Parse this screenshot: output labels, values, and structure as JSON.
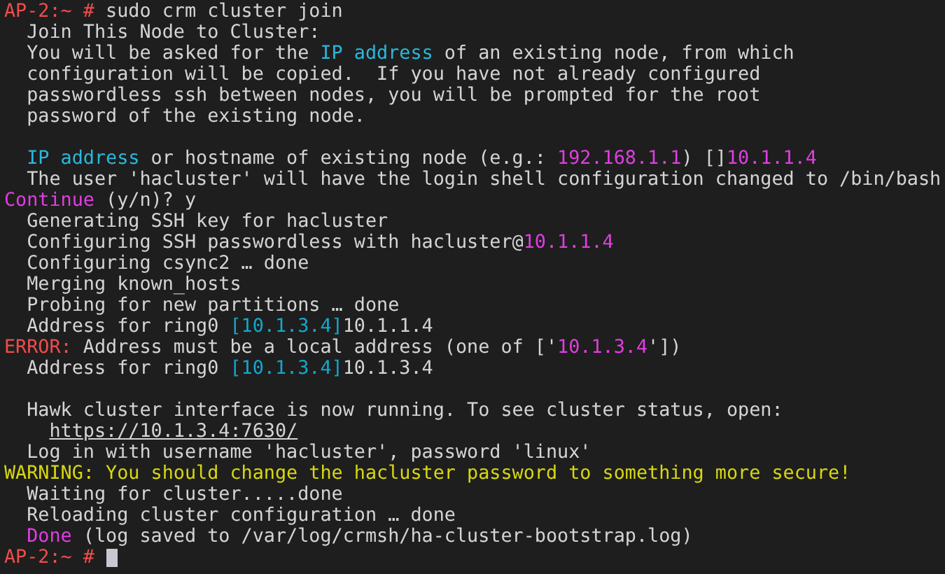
{
  "terminal": {
    "lines": [
      {
        "kind": "command",
        "segments": [
          {
            "text": "AP-2:~ #",
            "color": "#f14c4c"
          },
          {
            "text": " sudo crm cluster join"
          }
        ]
      },
      {
        "kind": "text",
        "segments": [
          {
            "text": "Join This Node to Cluster:"
          }
        ]
      },
      {
        "kind": "text",
        "segments": [
          {
            "text": "You will be asked for the "
          },
          {
            "text": "IP address",
            "color": "#29b8db"
          },
          {
            "text": " of an existing node, from which"
          }
        ]
      },
      {
        "kind": "text",
        "segments": [
          {
            "text": "configuration will be copied.  If you have not already configured"
          }
        ]
      },
      {
        "kind": "text",
        "segments": [
          {
            "text": "passwordless ssh between nodes, you will be prompted for the root"
          }
        ]
      },
      {
        "kind": "text",
        "segments": [
          {
            "text": "password of the existing node."
          }
        ]
      },
      {
        "kind": "blank"
      },
      {
        "kind": "text",
        "segments": [
          {
            "text": "IP address",
            "color": "#29b8db"
          },
          {
            "text": " or hostname of existing node (e.g.: "
          },
          {
            "text": "192.168.1.1",
            "color": "#e03ee0"
          },
          {
            "text": ") []"
          },
          {
            "text": "10.1.1.4",
            "color": "#e03ee0"
          }
        ]
      },
      {
        "kind": "text",
        "segments": [
          {
            "text": "The user 'hacluster' will have the login shell configuration changed to /bin/bash"
          }
        ]
      },
      {
        "kind": "status",
        "segments": [
          {
            "text": "Continue",
            "color": "#e03ee0"
          },
          {
            "text": " (y/n)? y"
          }
        ]
      },
      {
        "kind": "text",
        "segments": [
          {
            "text": "Generating SSH key for hacluster"
          }
        ]
      },
      {
        "kind": "text",
        "segments": [
          {
            "text": "Configuring SSH passwordless with hacluster@"
          },
          {
            "text": "10.1.1.4",
            "color": "#e03ee0"
          }
        ]
      },
      {
        "kind": "text",
        "segments": [
          {
            "text": "Configuring csync2 … done"
          }
        ]
      },
      {
        "kind": "text",
        "segments": [
          {
            "text": "Merging known_hosts"
          }
        ]
      },
      {
        "kind": "text",
        "segments": [
          {
            "text": "Probing for new partitions … done"
          }
        ]
      },
      {
        "kind": "text",
        "segments": [
          {
            "text": "Address for ring0 "
          },
          {
            "text": "[10.1.3.4]",
            "color": "#11a8cd"
          },
          {
            "text": "10.1.1.4"
          }
        ]
      },
      {
        "kind": "status",
        "segments": [
          {
            "text": "ERROR:",
            "color": "#f14c4c"
          },
          {
            "text": " Address must be a local address (one of ['"
          },
          {
            "text": "10.1.3.4",
            "color": "#e03ee0"
          },
          {
            "text": "'])"
          }
        ]
      },
      {
        "kind": "text",
        "segments": [
          {
            "text": "Address for ring0 "
          },
          {
            "text": "[10.1.3.4]",
            "color": "#11a8cd"
          },
          {
            "text": "10.1.3.4"
          }
        ]
      },
      {
        "kind": "blank"
      },
      {
        "kind": "text",
        "segments": [
          {
            "text": "Hawk cluster interface is now running. To see cluster status, open:"
          }
        ]
      },
      {
        "kind": "link",
        "segments": [
          {
            "text": "https://10.1.3.4:7630/"
          }
        ]
      },
      {
        "kind": "text",
        "segments": [
          {
            "text": "Log in with username 'hacluster', password 'linux'"
          }
        ]
      },
      {
        "kind": "status",
        "segments": [
          {
            "text": "WARNING: You should change the hacluster password to something more secure!",
            "color": "#d7d710"
          }
        ]
      },
      {
        "kind": "text",
        "segments": [
          {
            "text": "Waiting for cluster.....done"
          }
        ]
      },
      {
        "kind": "text",
        "segments": [
          {
            "text": "Reloading cluster configuration … done"
          }
        ]
      },
      {
        "kind": "text",
        "segments": [
          {
            "text": "Done",
            "color": "#e03ee0"
          },
          {
            "text": " (log saved to /var/log/crmsh/ha-cluster-bootstrap.log)"
          }
        ]
      },
      {
        "kind": "prompt",
        "segments": [
          {
            "text": "AP-2:~ #",
            "color": "#f14c4c"
          }
        ]
      }
    ]
  }
}
